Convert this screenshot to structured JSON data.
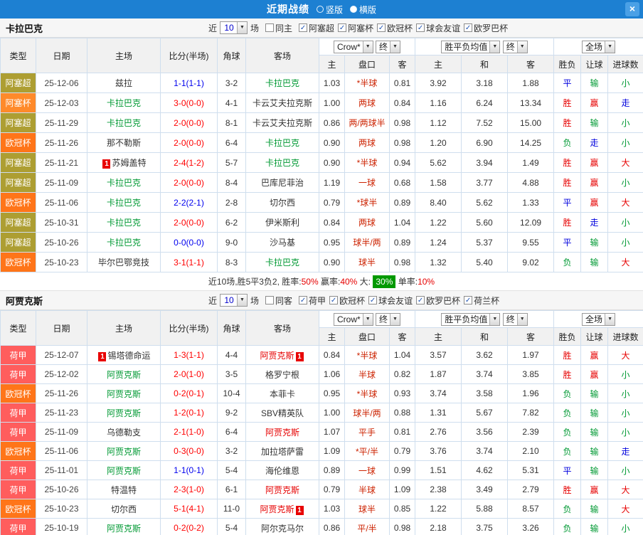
{
  "topbar": {
    "title": "近期战绩",
    "portrait": "竖版",
    "landscape": "横版",
    "close": "×"
  },
  "ui": {
    "near": "近",
    "games": "场"
  },
  "controls": {
    "bookmaker": "Crow*",
    "final": "终",
    "avg": "胜平负均值",
    "scope": "全场"
  },
  "headers": {
    "left": [
      "类型",
      "日期",
      "主场",
      "比分(半场)",
      "角球",
      "客场"
    ],
    "odds": [
      "主",
      "盘口",
      "客",
      "主",
      "和",
      "客",
      "胜负",
      "让球",
      "进球数"
    ]
  },
  "palette": {
    "red": "#e60000",
    "green": "#009933",
    "blue": "#0000dd",
    "dark": "#333333",
    "handicap": "#cc2200",
    "score_win": "#ff0000",
    "score_draw": "#0000ee",
    "badge_green": "#009900"
  },
  "value_colors": {
    "胜": "red",
    "平": "blue",
    "负": "green",
    "赢": "red",
    "输": "green",
    "走": "blue",
    "大": "red",
    "小": "green"
  },
  "league_colors": {
    "阿塞超": "#ad9e32",
    "阿塞杯": "#ff8a2a",
    "欧冠杯": "#ff7519",
    "荷甲": "#ff5d5d"
  },
  "section1": {
    "team": "卡拉巴克",
    "filter": {
      "count": "10",
      "same_label": "同主",
      "leagues": [
        "阿塞超",
        "阿塞杯",
        "欧冠杯",
        "球会友谊",
        "欧罗巴杯"
      ]
    },
    "rows": [
      {
        "type": "阿塞超",
        "date": "25-12-06",
        "home": "兹拉",
        "home_hl": "",
        "home_card": "",
        "score": "1-1(1-1)",
        "score_hl": "draw",
        "corners": "3-2",
        "away": "卡拉巴克",
        "away_hl": "green",
        "away_card": "",
        "h_home": "1.03",
        "h_line": "*半球",
        "h_away": "0.81",
        "e_home": "3.92",
        "e_draw": "3.18",
        "e_away": "1.88",
        "res": "平",
        "give": "输",
        "goals": "小"
      },
      {
        "type": "阿塞杯",
        "date": "25-12-03",
        "home": "卡拉巴克",
        "home_hl": "green",
        "home_card": "",
        "score": "3-0(0-0)",
        "score_hl": "win",
        "corners": "4-1",
        "away": "卡云艾夫拉克斯",
        "away_hl": "",
        "away_card": "",
        "h_home": "1.00",
        "h_line": "两球",
        "h_away": "0.84",
        "e_home": "1.16",
        "e_draw": "6.24",
        "e_away": "13.34",
        "res": "胜",
        "give": "赢",
        "goals": "走"
      },
      {
        "type": "阿塞超",
        "date": "25-11-29",
        "home": "卡拉巴克",
        "home_hl": "green",
        "home_card": "",
        "score": "2-0(0-0)",
        "score_hl": "win",
        "corners": "8-1",
        "away": "卡云艾夫拉克斯",
        "away_hl": "",
        "away_card": "",
        "h_home": "0.86",
        "h_line": "两/两球半",
        "h_away": "0.98",
        "e_home": "1.12",
        "e_draw": "7.52",
        "e_away": "15.00",
        "res": "胜",
        "give": "输",
        "goals": "小"
      },
      {
        "type": "欧冠杯",
        "date": "25-11-26",
        "home": "那不勒斯",
        "home_hl": "",
        "home_card": "",
        "score": "2-0(0-0)",
        "score_hl": "win",
        "corners": "6-4",
        "away": "卡拉巴克",
        "away_hl": "green",
        "away_card": "",
        "h_home": "0.90",
        "h_line": "两球",
        "h_away": "0.98",
        "e_home": "1.20",
        "e_draw": "6.90",
        "e_away": "14.25",
        "res": "负",
        "give": "走",
        "goals": "小"
      },
      {
        "type": "阿塞超",
        "date": "25-11-21",
        "home": "苏姆盖特",
        "home_hl": "",
        "home_card": "1",
        "score": "2-4(1-2)",
        "score_hl": "win",
        "corners": "5-7",
        "away": "卡拉巴克",
        "away_hl": "green",
        "away_card": "",
        "h_home": "0.90",
        "h_line": "*半球",
        "h_away": "0.94",
        "e_home": "5.62",
        "e_draw": "3.94",
        "e_away": "1.49",
        "res": "胜",
        "give": "赢",
        "goals": "大"
      },
      {
        "type": "阿塞超",
        "date": "25-11-09",
        "home": "卡拉巴克",
        "home_hl": "green",
        "home_card": "",
        "score": "2-0(0-0)",
        "score_hl": "win",
        "corners": "8-4",
        "away": "巴库尼菲治",
        "away_hl": "",
        "away_card": "",
        "h_home": "1.19",
        "h_line": "一球",
        "h_away": "0.68",
        "e_home": "1.58",
        "e_draw": "3.77",
        "e_away": "4.88",
        "res": "胜",
        "give": "赢",
        "goals": "小"
      },
      {
        "type": "欧冠杯",
        "date": "25-11-06",
        "home": "卡拉巴克",
        "home_hl": "green",
        "home_card": "",
        "score": "2-2(2-1)",
        "score_hl": "draw",
        "corners": "2-8",
        "away": "切尔西",
        "away_hl": "",
        "away_card": "",
        "h_home": "0.79",
        "h_line": "*球半",
        "h_away": "0.89",
        "e_home": "8.40",
        "e_draw": "5.62",
        "e_away": "1.33",
        "res": "平",
        "give": "赢",
        "goals": "大"
      },
      {
        "type": "阿塞超",
        "date": "25-10-31",
        "home": "卡拉巴克",
        "home_hl": "green",
        "home_card": "",
        "score": "2-0(0-0)",
        "score_hl": "win",
        "corners": "6-2",
        "away": "伊米斯利",
        "away_hl": "",
        "away_card": "",
        "h_home": "0.84",
        "h_line": "两球",
        "h_away": "1.04",
        "e_home": "1.22",
        "e_draw": "5.60",
        "e_away": "12.09",
        "res": "胜",
        "give": "走",
        "goals": "小"
      },
      {
        "type": "阿塞超",
        "date": "25-10-26",
        "home": "卡拉巴克",
        "home_hl": "green",
        "home_card": "",
        "score": "0-0(0-0)",
        "score_hl": "draw",
        "corners": "9-0",
        "away": "沙马基",
        "away_hl": "",
        "away_card": "",
        "h_home": "0.95",
        "h_line": "球半/两",
        "h_away": "0.89",
        "e_home": "1.24",
        "e_draw": "5.37",
        "e_away": "9.55",
        "res": "平",
        "give": "输",
        "goals": "小"
      },
      {
        "type": "欧冠杯",
        "date": "25-10-23",
        "home": "毕尔巴鄂竞技",
        "home_hl": "",
        "home_card": "",
        "score": "3-1(1-1)",
        "score_hl": "win",
        "corners": "8-3",
        "away": "卡拉巴克",
        "away_hl": "green",
        "away_card": "",
        "h_home": "0.90",
        "h_line": "球半",
        "h_away": "0.98",
        "e_home": "1.32",
        "e_draw": "5.40",
        "e_away": "9.02",
        "res": "负",
        "give": "输",
        "goals": "大"
      }
    ],
    "summary": [
      {
        "t": "近10场,胜5平3负2,  ",
        "s": "plain"
      },
      {
        "t": "胜率:",
        "s": "plain"
      },
      {
        "t": "50%",
        "s": "red"
      },
      {
        "t": "  赢率:",
        "s": "plain"
      },
      {
        "t": "40%",
        "s": "red"
      },
      {
        "t": "  大: ",
        "s": "plain"
      },
      {
        "t": "30%",
        "s": "badge"
      },
      {
        "t": "  单率:",
        "s": "plain"
      },
      {
        "t": "10%",
        "s": "red"
      }
    ]
  },
  "section2": {
    "team": "阿贾克斯",
    "filter": {
      "count": "10",
      "same_label": "同客",
      "leagues": [
        "荷甲",
        "欧冠杯",
        "球会友谊",
        "欧罗巴杯",
        "荷兰杯"
      ]
    },
    "rows": [
      {
        "type": "荷甲",
        "date": "25-12-07",
        "home": "锡塔德命运",
        "home_hl": "",
        "home_card": "1",
        "score": "1-3(1-1)",
        "score_hl": "win",
        "corners": "4-4",
        "away": "阿贾克斯",
        "away_hl": "red",
        "away_card": "1",
        "h_home": "0.84",
        "h_line": "*半球",
        "h_away": "1.04",
        "e_home": "3.57",
        "e_draw": "3.62",
        "e_away": "1.97",
        "res": "胜",
        "give": "赢",
        "goals": "大"
      },
      {
        "type": "荷甲",
        "date": "25-12-02",
        "home": "阿贾克斯",
        "home_hl": "green",
        "home_card": "",
        "score": "2-0(1-0)",
        "score_hl": "win",
        "corners": "3-5",
        "away": "格罗宁根",
        "away_hl": "",
        "away_card": "",
        "h_home": "1.06",
        "h_line": "半球",
        "h_away": "0.82",
        "e_home": "1.87",
        "e_draw": "3.74",
        "e_away": "3.85",
        "res": "胜",
        "give": "赢",
        "goals": "小"
      },
      {
        "type": "欧冠杯",
        "date": "25-11-26",
        "home": "阿贾克斯",
        "home_hl": "green",
        "home_card": "",
        "score": "0-2(0-1)",
        "score_hl": "win",
        "corners": "10-4",
        "away": "本菲卡",
        "away_hl": "",
        "away_card": "",
        "h_home": "0.95",
        "h_line": "*半球",
        "h_away": "0.93",
        "e_home": "3.74",
        "e_draw": "3.58",
        "e_away": "1.96",
        "res": "负",
        "give": "输",
        "goals": "小"
      },
      {
        "type": "荷甲",
        "date": "25-11-23",
        "home": "阿贾克斯",
        "home_hl": "green",
        "home_card": "",
        "score": "1-2(0-1)",
        "score_hl": "win",
        "corners": "9-2",
        "away": "SBV精英队",
        "away_hl": "",
        "away_card": "",
        "h_home": "1.00",
        "h_line": "球半/两",
        "h_away": "0.88",
        "e_home": "1.31",
        "e_draw": "5.67",
        "e_away": "7.82",
        "res": "负",
        "give": "输",
        "goals": "小"
      },
      {
        "type": "荷甲",
        "date": "25-11-09",
        "home": "乌德勒支",
        "home_hl": "",
        "home_card": "",
        "score": "2-1(1-0)",
        "score_hl": "win",
        "corners": "6-4",
        "away": "阿贾克斯",
        "away_hl": "red",
        "away_card": "",
        "h_home": "1.07",
        "h_line": "平手",
        "h_away": "0.81",
        "e_home": "2.76",
        "e_draw": "3.56",
        "e_away": "2.39",
        "res": "负",
        "give": "输",
        "goals": "小"
      },
      {
        "type": "欧冠杯",
        "date": "25-11-06",
        "home": "阿贾克斯",
        "home_hl": "green",
        "home_card": "",
        "score": "0-3(0-0)",
        "score_hl": "win",
        "corners": "3-2",
        "away": "加拉塔萨雷",
        "away_hl": "",
        "away_card": "",
        "h_home": "1.09",
        "h_line": "*平/半",
        "h_away": "0.79",
        "e_home": "3.76",
        "e_draw": "3.74",
        "e_away": "2.10",
        "res": "负",
        "give": "输",
        "goals": "走"
      },
      {
        "type": "荷甲",
        "date": "25-11-01",
        "home": "阿贾克斯",
        "home_hl": "green",
        "home_card": "",
        "score": "1-1(0-1)",
        "score_hl": "draw",
        "corners": "5-4",
        "away": "海伦维恩",
        "away_hl": "",
        "away_card": "",
        "h_home": "0.89",
        "h_line": "一球",
        "h_away": "0.99",
        "e_home": "1.51",
        "e_draw": "4.62",
        "e_away": "5.31",
        "res": "平",
        "give": "输",
        "goals": "小"
      },
      {
        "type": "荷甲",
        "date": "25-10-26",
        "home": "特温特",
        "home_hl": "",
        "home_card": "",
        "score": "2-3(1-0)",
        "score_hl": "win",
        "corners": "6-1",
        "away": "阿贾克斯",
        "away_hl": "red",
        "away_card": "",
        "h_home": "0.79",
        "h_line": "半球",
        "h_away": "1.09",
        "e_home": "2.38",
        "e_draw": "3.49",
        "e_away": "2.79",
        "res": "胜",
        "give": "赢",
        "goals": "大"
      },
      {
        "type": "欧冠杯",
        "date": "25-10-23",
        "home": "切尔西",
        "home_hl": "",
        "home_card": "",
        "score": "5-1(4-1)",
        "score_hl": "win",
        "corners": "11-0",
        "away": "阿贾克斯",
        "away_hl": "red",
        "away_card": "1",
        "h_home": "1.03",
        "h_line": "球半",
        "h_away": "0.85",
        "e_home": "1.22",
        "e_draw": "5.88",
        "e_away": "8.57",
        "res": "负",
        "give": "输",
        "goals": "大"
      },
      {
        "type": "荷甲",
        "date": "25-10-19",
        "home": "阿贾克斯",
        "home_hl": "green",
        "home_card": "",
        "score": "0-2(0-2)",
        "score_hl": "win",
        "corners": "5-4",
        "away": "阿尔克马尔",
        "away_hl": "",
        "away_card": "",
        "h_home": "0.86",
        "h_line": "平/半",
        "h_away": "0.98",
        "e_home": "2.18",
        "e_draw": "3.75",
        "e_away": "3.26",
        "res": "负",
        "give": "输",
        "goals": "小"
      }
    ]
  }
}
